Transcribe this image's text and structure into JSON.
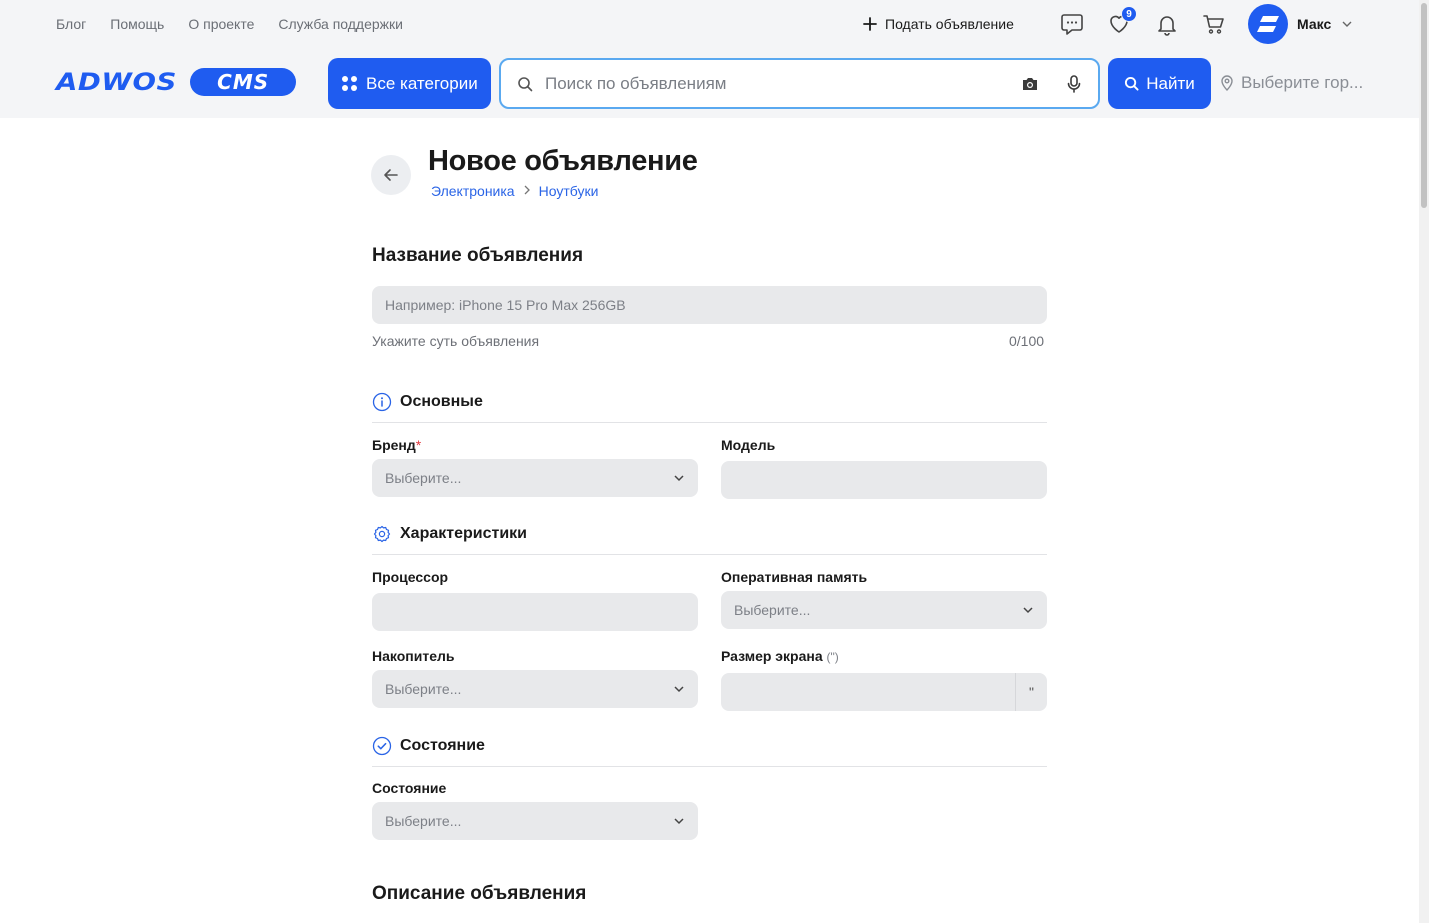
{
  "header": {
    "top_links": [
      "Блог",
      "Помощь",
      "О проекте",
      "Служба поддержки"
    ],
    "post_ad_label": "Подать объявление",
    "favorites_count": "9",
    "user_name": "Макс",
    "logo_word": "ADWOS",
    "logo_pill": "CMS",
    "categories_label": "Все категории",
    "search_placeholder": "Поиск по объявлениям",
    "find_label": "Найти",
    "city_placeholder": "Выберите гор...",
    "accent_color": "#1f5cf0"
  },
  "page": {
    "title": "Новое объявление",
    "breadcrumb": [
      "Электроника",
      "Ноутбуки"
    ]
  },
  "title_section": {
    "heading": "Название объявления",
    "placeholder": "Например: iPhone 15 Pro Max 256GB",
    "hint": "Укажите суть объявления",
    "counter": "0/100"
  },
  "groups": {
    "basic": {
      "heading": "Основные",
      "icon": "info-icon",
      "brand_label": "Бренд",
      "brand_required": "*",
      "brand_value": "Выберите...",
      "model_label": "Модель"
    },
    "specs": {
      "heading": "Характеристики",
      "icon": "gear-icon",
      "cpu_label": "Процессор",
      "ram_label": "Оперативная память",
      "ram_value": "Выберите...",
      "storage_label": "Накопитель",
      "storage_value": "Выберите...",
      "screen_label": "Размер экрана",
      "screen_unit": "(\")",
      "screen_suffix": "\""
    },
    "condition": {
      "heading": "Состояние",
      "icon": "check-circle-icon",
      "condition_label": "Состояние",
      "condition_value": "Выберите..."
    }
  },
  "description_section": {
    "heading": "Описание объявления"
  }
}
